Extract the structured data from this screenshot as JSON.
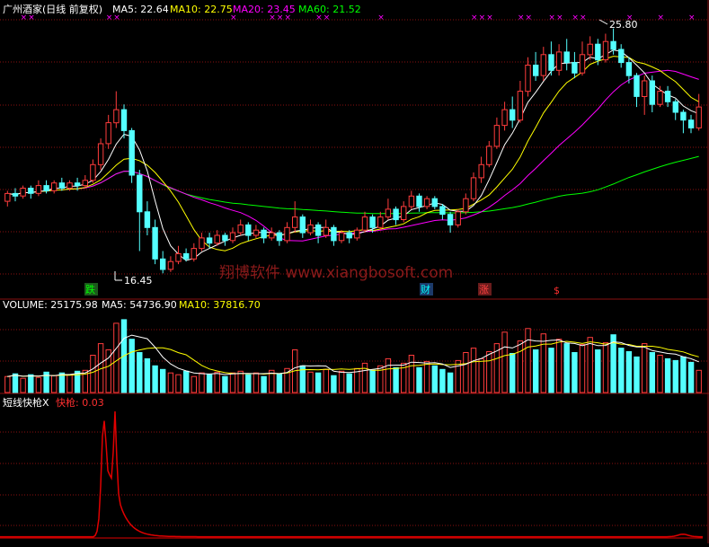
{
  "main_panel": {
    "title": "广州酒家(日线 前复权)",
    "indicators": [
      {
        "label": "MA5: 22.64",
        "color": "#ffffff"
      },
      {
        "label": "MA10: 22.75",
        "color": "#ffff00"
      },
      {
        "label": "MA20: 23.45",
        "color": "#ff00ff"
      },
      {
        "label": "MA60: 21.52",
        "color": "#00ff00"
      }
    ],
    "high_label": "25.80",
    "low_label": "16.45",
    "markers": [
      {
        "text": "跌",
        "color": "#00ff00",
        "bg": "#1c5a1c"
      },
      {
        "text": "财",
        "color": "#00ffff",
        "bg": "#1c3a6a"
      },
      {
        "text": "涨",
        "color": "#ff4040",
        "bg": "#6a1c1c"
      },
      {
        "text": "$",
        "color": "#ff3030",
        "bg": ""
      }
    ],
    "watermark": "翔博软件 www.xiangbosoft.com"
  },
  "volume_panel": {
    "indicators": [
      {
        "label": "VOLUME: 25175.98",
        "color": "#ffffff"
      },
      {
        "label": "MA5: 54736.90",
        "color": "#ffffff"
      },
      {
        "label": "MA10: 37816.70",
        "color": "#ffff00"
      }
    ]
  },
  "indicator_panel": {
    "indicators": [
      {
        "label": "短线快枪X",
        "color": "#ffffff"
      },
      {
        "label": "快枪: 0.03",
        "color": "#ff3030"
      }
    ]
  },
  "colors": {
    "up": "#ff3c3c",
    "down": "#54ffff",
    "grid": "#8a1010",
    "ma5": "#ffffff",
    "ma10": "#ffff00",
    "ma20": "#ff00ff",
    "ma60": "#00ff00",
    "signal": "#ff00ff",
    "quickgun": "#e00000"
  },
  "chart_data": [
    {
      "type": "candlestick",
      "title": "广州酒家(日线 前复权)",
      "ylim": [
        15.5,
        26.2
      ],
      "high": 25.8,
      "low": 16.45,
      "candles": [
        [
          19.2,
          19.5,
          19.0,
          19.6
        ],
        [
          19.5,
          19.4,
          19.2,
          19.7
        ],
        [
          19.4,
          19.7,
          19.3,
          19.8
        ],
        [
          19.7,
          19.5,
          19.3,
          19.8
        ],
        [
          19.5,
          19.8,
          19.4,
          20.0
        ],
        [
          19.8,
          19.6,
          19.5,
          20.0
        ],
        [
          19.6,
          19.9,
          19.5,
          20.0
        ],
        [
          19.9,
          19.7,
          19.6,
          20.1
        ],
        [
          19.7,
          19.9,
          19.6,
          20.0
        ],
        [
          19.9,
          19.8,
          19.6,
          20.1
        ],
        [
          19.8,
          20.0,
          19.7,
          20.2
        ],
        [
          20.0,
          20.6,
          19.9,
          20.8
        ],
        [
          20.6,
          21.4,
          20.4,
          21.6
        ],
        [
          21.4,
          22.2,
          21.2,
          22.5
        ],
        [
          22.2,
          22.7,
          22.0,
          23.4
        ],
        [
          22.7,
          21.9,
          21.6,
          22.9
        ],
        [
          21.9,
          20.2,
          19.9,
          22.0
        ],
        [
          20.2,
          18.8,
          17.3,
          20.4
        ],
        [
          18.8,
          18.2,
          17.9,
          19.2
        ],
        [
          18.2,
          17.0,
          16.8,
          18.5
        ],
        [
          17.0,
          16.6,
          16.45,
          17.3
        ],
        [
          16.6,
          16.9,
          16.5,
          17.1
        ],
        [
          16.9,
          17.2,
          16.8,
          17.5
        ],
        [
          17.2,
          17.0,
          16.9,
          17.4
        ],
        [
          17.0,
          17.4,
          16.9,
          17.6
        ],
        [
          17.4,
          17.8,
          17.3,
          18.0
        ],
        [
          17.8,
          17.6,
          17.4,
          18.0
        ],
        [
          17.6,
          17.9,
          17.5,
          18.1
        ],
        [
          17.9,
          17.7,
          17.5,
          18.0
        ],
        [
          17.7,
          18.0,
          17.6,
          18.2
        ],
        [
          18.0,
          18.3,
          17.9,
          18.5
        ],
        [
          18.3,
          17.9,
          17.7,
          18.4
        ],
        [
          17.9,
          18.1,
          17.8,
          18.3
        ],
        [
          18.1,
          17.8,
          17.6,
          18.2
        ],
        [
          17.8,
          18.0,
          17.7,
          18.2
        ],
        [
          18.0,
          17.7,
          17.5,
          18.1
        ],
        [
          17.7,
          18.2,
          17.6,
          18.4
        ],
        [
          18.2,
          18.6,
          18.0,
          19.2
        ],
        [
          18.6,
          18.0,
          17.8,
          18.7
        ],
        [
          18.0,
          18.3,
          17.9,
          18.5
        ],
        [
          18.3,
          17.9,
          17.6,
          18.4
        ],
        [
          17.9,
          18.2,
          17.8,
          18.5
        ],
        [
          18.2,
          17.7,
          17.5,
          18.3
        ],
        [
          17.7,
          18.0,
          17.6,
          18.1
        ],
        [
          18.0,
          17.8,
          17.6,
          18.1
        ],
        [
          17.8,
          18.1,
          17.7,
          18.2
        ],
        [
          18.1,
          18.6,
          18.0,
          18.8
        ],
        [
          18.6,
          18.2,
          18.0,
          18.7
        ],
        [
          18.2,
          18.6,
          18.1,
          18.8
        ],
        [
          18.6,
          18.9,
          18.5,
          19.3
        ],
        [
          18.9,
          18.5,
          18.3,
          19.0
        ],
        [
          18.5,
          19.0,
          18.4,
          19.2
        ],
        [
          19.0,
          19.4,
          18.9,
          19.6
        ],
        [
          19.4,
          19.0,
          18.8,
          19.5
        ],
        [
          19.0,
          19.3,
          18.9,
          19.4
        ],
        [
          19.3,
          19.0,
          18.9,
          19.4
        ],
        [
          19.0,
          18.7,
          18.5,
          19.1
        ],
        [
          18.7,
          18.3,
          18.0,
          18.8
        ],
        [
          18.3,
          18.8,
          18.2,
          18.9
        ],
        [
          18.8,
          19.3,
          18.7,
          19.5
        ],
        [
          19.3,
          20.1,
          19.2,
          20.3
        ],
        [
          20.1,
          20.6,
          19.9,
          20.9
        ],
        [
          20.6,
          21.3,
          20.5,
          21.5
        ],
        [
          21.3,
          22.1,
          21.2,
          22.4
        ],
        [
          22.1,
          22.7,
          21.9,
          23.0
        ],
        [
          22.7,
          22.3,
          22.0,
          23.2
        ],
        [
          22.3,
          23.4,
          22.2,
          23.8
        ],
        [
          23.4,
          24.4,
          23.2,
          24.7
        ],
        [
          24.4,
          24.0,
          23.8,
          24.9
        ],
        [
          24.0,
          24.8,
          23.8,
          25.1
        ],
        [
          24.8,
          24.2,
          24.0,
          25.3
        ],
        [
          24.2,
          24.9,
          24.0,
          25.2
        ],
        [
          24.9,
          24.5,
          24.2,
          25.4
        ],
        [
          24.5,
          24.1,
          23.9,
          24.9
        ],
        [
          24.1,
          24.8,
          24.0,
          25.3
        ],
        [
          24.8,
          25.2,
          24.6,
          25.5
        ],
        [
          25.2,
          24.6,
          24.4,
          25.4
        ],
        [
          24.6,
          25.3,
          24.5,
          25.6
        ],
        [
          25.3,
          25.0,
          24.8,
          25.8
        ],
        [
          25.0,
          24.5,
          24.3,
          25.2
        ],
        [
          24.5,
          24.0,
          23.7,
          24.7
        ],
        [
          24.0,
          23.2,
          22.8,
          24.1
        ],
        [
          23.2,
          23.8,
          22.5,
          24.0
        ],
        [
          23.8,
          22.9,
          22.6,
          24.0
        ],
        [
          22.9,
          23.4,
          22.8,
          23.6
        ],
        [
          23.4,
          23.0,
          22.8,
          23.6
        ],
        [
          23.0,
          22.6,
          22.3,
          23.1
        ],
        [
          22.6,
          22.3,
          21.8,
          22.7
        ],
        [
          22.3,
          22.0,
          21.8,
          22.5
        ],
        [
          22.0,
          22.8,
          21.9,
          23.3
        ]
      ]
    },
    {
      "type": "bar",
      "title": "VOLUME",
      "ylim": [
        0,
        90000
      ],
      "values": [
        18000,
        21000,
        16000,
        20000,
        17000,
        23000,
        19000,
        22000,
        20000,
        24000,
        25000,
        42000,
        55000,
        48000,
        78000,
        82000,
        60000,
        45000,
        38000,
        30000,
        26000,
        22000,
        20000,
        24000,
        18000,
        22000,
        20000,
        23000,
        18000,
        22000,
        24000,
        20000,
        22000,
        18000,
        25000,
        21000,
        27000,
        48000,
        30000,
        23000,
        22000,
        26000,
        19000,
        24000,
        21000,
        27000,
        33000,
        25000,
        30000,
        38000,
        28000,
        33000,
        42000,
        28000,
        35000,
        30000,
        26000,
        22000,
        36000,
        45000,
        50000,
        38000,
        46000,
        55000,
        68000,
        44000,
        58000,
        72000,
        48000,
        66000,
        50000,
        60000,
        55000,
        45000,
        54000,
        62000,
        48000,
        56000,
        65000,
        50000,
        46000,
        40000,
        55000,
        45000,
        42000,
        38000,
        36000,
        40000,
        34000,
        25000
      ]
    },
    {
      "type": "line",
      "title": "短线快枪X",
      "series": [
        {
          "name": "快枪"
        }
      ]
    }
  ]
}
